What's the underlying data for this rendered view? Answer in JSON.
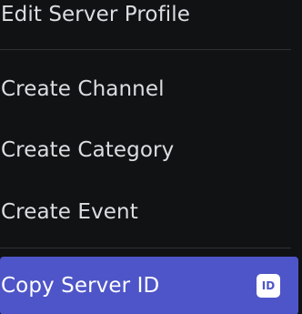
{
  "menu": {
    "items": [
      {
        "label": "Edit Server Profile"
      },
      {
        "label": "Create Channel"
      },
      {
        "label": "Create Category"
      },
      {
        "label": "Create Event"
      },
      {
        "label": "Copy Server ID",
        "icon": "id-icon",
        "icon_text": "ID"
      }
    ]
  },
  "colors": {
    "background": "#111214",
    "text": "#dbdee1",
    "highlight": "#4e55c8",
    "divider": "#2e3035"
  }
}
